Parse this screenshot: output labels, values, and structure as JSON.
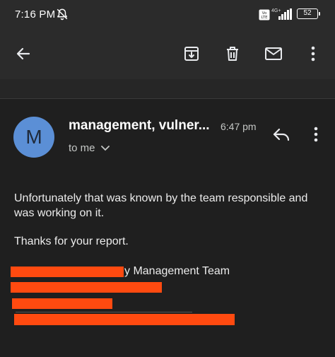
{
  "status_bar": {
    "time": "7:16 PM",
    "volte": "Vo LTE",
    "network": "4G+",
    "battery": "52",
    "icons": [
      "bell-muted-icon",
      "volte-icon",
      "signal-icon",
      "battery-icon"
    ]
  },
  "toolbar": {
    "icons": [
      "back-arrow-icon",
      "archive-icon",
      "delete-icon",
      "mail-icon",
      "more-vert-icon"
    ]
  },
  "email": {
    "avatar_letter": "M",
    "sender": "management, vulner...",
    "time": "6:47 pm",
    "recipient": "to me",
    "body_paragraph_1": "Unfortunately that was known by the team responsible and was working on it.",
    "body_paragraph_2": "Thanks for your report.",
    "signature_visible": "y Management Team"
  },
  "colors": {
    "background": "#1f1f1f",
    "toolbar": "#2b2b2b",
    "avatar": "#5b8fd6",
    "redaction": "#ff4a10"
  }
}
